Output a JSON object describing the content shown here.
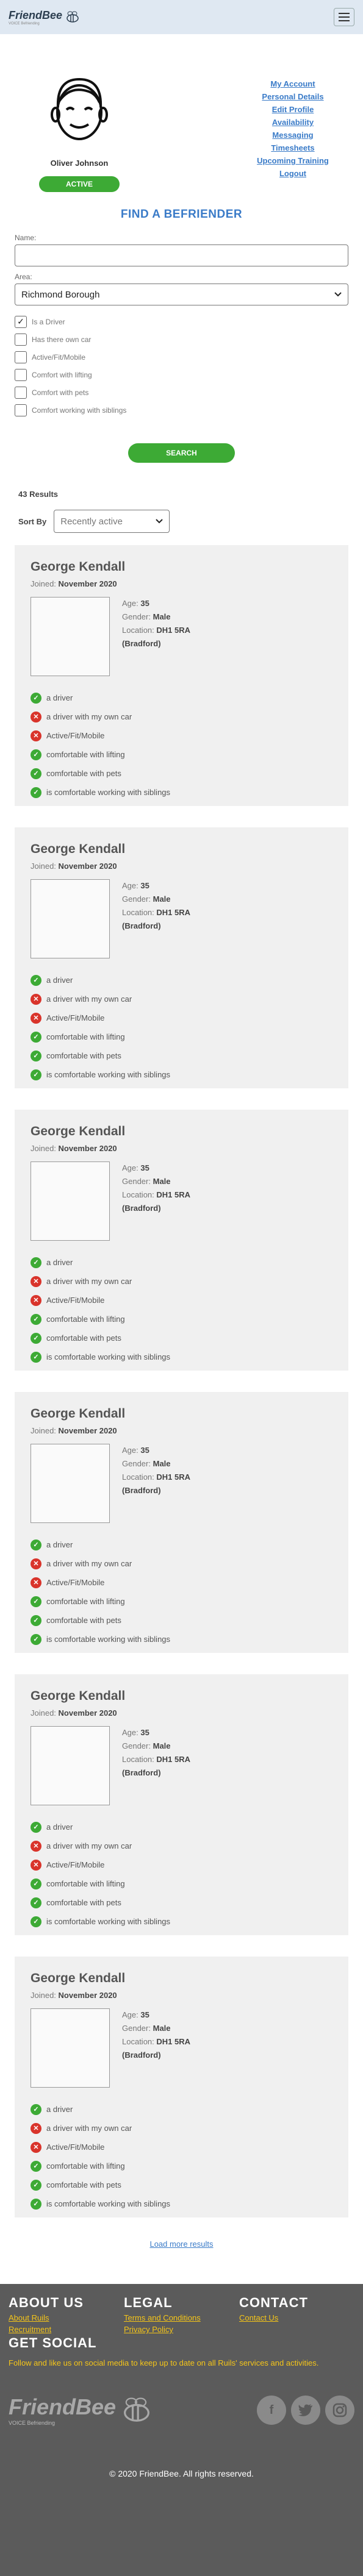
{
  "header": {
    "logo_text": "FriendBee",
    "logo_sub": "VOICE Befriending"
  },
  "profile": {
    "name": "Oliver Johnson",
    "status": "ACTIVE"
  },
  "menu": [
    "My Account",
    "Personal Details",
    "Edit Profile",
    "Availability",
    "Messaging",
    "Timesheets",
    "Upcoming Training",
    "Logout"
  ],
  "search": {
    "title": "FIND A BEFRIENDER",
    "name_label": "Name:",
    "name_value": "",
    "area_label": "Area:",
    "area_value": "Richmond Borough",
    "options": [
      {
        "label": "Is a Driver",
        "checked": true
      },
      {
        "label": "Has there own car",
        "checked": false
      },
      {
        "label": "Active/Fit/Mobile",
        "checked": false
      },
      {
        "label": "Comfort with lifting",
        "checked": false
      },
      {
        "label": "Comfort with pets",
        "checked": false
      },
      {
        "label": "Comfort working with siblings",
        "checked": false
      }
    ],
    "button": "SEARCH"
  },
  "results": {
    "count": "43 Results",
    "sort_label": "Sort By",
    "sort_value": "Recently active",
    "load_more": "Load more results"
  },
  "cards": [
    {
      "name": "George Kendall",
      "joined_label": "Joined:",
      "joined": "November 2020",
      "age_label": "Age:",
      "age": "35",
      "gender_label": "Gender:",
      "gender": "Male",
      "location_label": "Location:",
      "location": "DH1 5RA",
      "town": "(Bradford)",
      "traits": [
        {
          "text": "a driver",
          "ok": true
        },
        {
          "text": "a driver with my own car",
          "ok": false
        },
        {
          "text": "Active/Fit/Mobile",
          "ok": false
        },
        {
          "text": "comfortable with lifting",
          "ok": true
        },
        {
          "text": "comfortable with pets",
          "ok": true
        },
        {
          "text": "is comfortable working with siblings",
          "ok": true
        }
      ]
    },
    {
      "name": "George Kendall",
      "joined_label": "Joined:",
      "joined": "November 2020",
      "age_label": "Age:",
      "age": "35",
      "gender_label": "Gender:",
      "gender": "Male",
      "location_label": "Location:",
      "location": "DH1 5RA",
      "town": "(Bradford)",
      "traits": [
        {
          "text": "a driver",
          "ok": true
        },
        {
          "text": "a driver with my own car",
          "ok": false
        },
        {
          "text": "Active/Fit/Mobile",
          "ok": false
        },
        {
          "text": "comfortable with lifting",
          "ok": true
        },
        {
          "text": "comfortable with pets",
          "ok": true
        },
        {
          "text": "is comfortable working with siblings",
          "ok": true
        }
      ]
    },
    {
      "name": "George Kendall",
      "joined_label": "Joined:",
      "joined": "November 2020",
      "age_label": "Age:",
      "age": "35",
      "gender_label": "Gender:",
      "gender": "Male",
      "location_label": "Location:",
      "location": "DH1 5RA",
      "town": "(Bradford)",
      "traits": [
        {
          "text": "a driver",
          "ok": true
        },
        {
          "text": "a driver with my own car",
          "ok": false
        },
        {
          "text": "Active/Fit/Mobile",
          "ok": false
        },
        {
          "text": "comfortable with lifting",
          "ok": true
        },
        {
          "text": "comfortable with pets",
          "ok": true
        },
        {
          "text": "is comfortable working with siblings",
          "ok": true
        }
      ]
    },
    {
      "name": "George Kendall",
      "joined_label": "Joined:",
      "joined": "November 2020",
      "age_label": "Age:",
      "age": "35",
      "gender_label": "Gender:",
      "gender": "Male",
      "location_label": "Location:",
      "location": "DH1 5RA",
      "town": "(Bradford)",
      "traits": [
        {
          "text": "a driver",
          "ok": true
        },
        {
          "text": "a driver with my own car",
          "ok": false
        },
        {
          "text": "Active/Fit/Mobile",
          "ok": false
        },
        {
          "text": "comfortable with lifting",
          "ok": true
        },
        {
          "text": "comfortable with pets",
          "ok": true
        },
        {
          "text": "is comfortable working with siblings",
          "ok": true
        }
      ]
    },
    {
      "name": "George Kendall",
      "joined_label": "Joined:",
      "joined": "November 2020",
      "age_label": "Age:",
      "age": "35",
      "gender_label": "Gender:",
      "gender": "Male",
      "location_label": "Location:",
      "location": "DH1 5RA",
      "town": "(Bradford)",
      "traits": [
        {
          "text": "a driver",
          "ok": true
        },
        {
          "text": "a driver with my own car",
          "ok": false
        },
        {
          "text": "Active/Fit/Mobile",
          "ok": false
        },
        {
          "text": "comfortable with lifting",
          "ok": true
        },
        {
          "text": "comfortable with pets",
          "ok": true
        },
        {
          "text": "is comfortable working with siblings",
          "ok": true
        }
      ]
    },
    {
      "name": "George Kendall",
      "joined_label": "Joined:",
      "joined": "November 2020",
      "age_label": "Age:",
      "age": "35",
      "gender_label": "Gender:",
      "gender": "Male",
      "location_label": "Location:",
      "location": "DH1 5RA",
      "town": "(Bradford)",
      "traits": [
        {
          "text": "a driver",
          "ok": true
        },
        {
          "text": "a driver with my own car",
          "ok": false
        },
        {
          "text": "Active/Fit/Mobile",
          "ok": false
        },
        {
          "text": "comfortable with lifting",
          "ok": true
        },
        {
          "text": "comfortable with pets",
          "ok": true
        },
        {
          "text": "is comfortable working with siblings",
          "ok": true
        }
      ]
    }
  ],
  "footer": {
    "about_title": "ABOUT US",
    "about_links": [
      "About Ruils",
      "Recruitment"
    ],
    "legal_title": "LEGAL",
    "legal_links": [
      "Terms and Conditions",
      "Privacy Policy"
    ],
    "contact_title": "CONTACT",
    "contact_links": [
      "Contact Us"
    ],
    "social_title": "GET SOCIAL",
    "social_text": "Follow and like us on social media to keep up to date on all Ruils' services and activities.",
    "logo_text": "FriendBee",
    "logo_sub": "VOICE Befriending",
    "social_icons": [
      "facebook-icon",
      "twitter-icon",
      "instagram-icon"
    ],
    "copyright": "© 2020 FriendBee. All rights reserved."
  },
  "colors": {
    "accent_blue": "#3a7bc8",
    "green": "#3daa35",
    "red": "#d9342b",
    "footer_bg": "#5b5b5b",
    "footer_link": "#f5c518"
  }
}
